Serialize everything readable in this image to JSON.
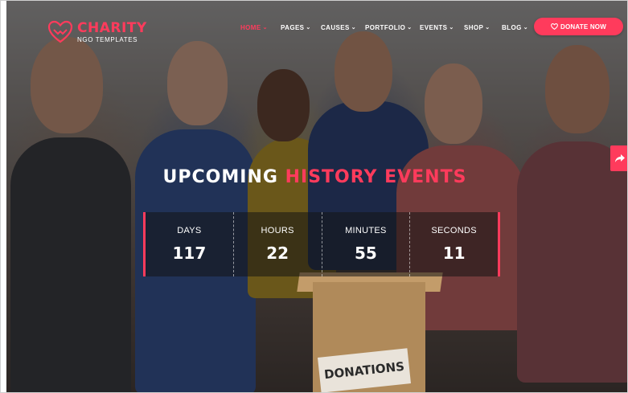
{
  "brand": {
    "name": "CHARITY",
    "tagline": "NGO TEMPLATES",
    "accent_color": "#ff3b5c",
    "logo_icon": "heart-hands-icon"
  },
  "nav": {
    "items": [
      {
        "label": "HOME",
        "has_caret": true,
        "active": true
      },
      {
        "label": "PAGES",
        "has_caret": true,
        "active": false
      },
      {
        "label": "CAUSES",
        "has_caret": true,
        "active": false
      },
      {
        "label": "PORTFOLIO",
        "has_caret": true,
        "active": false
      },
      {
        "label": "EVENTS",
        "has_caret": true,
        "active": false
      },
      {
        "label": "SHOP",
        "has_caret": true,
        "active": false
      },
      {
        "label": "BLOG",
        "has_caret": true,
        "active": false
      }
    ],
    "donate_label": "DONATE NOW",
    "donate_icon": "heart-icon"
  },
  "share": {
    "icon": "share-arrow-icon"
  },
  "hero": {
    "headline_white": "UPCOMING",
    "headline_pink": "HISTORY EVENTS",
    "box_label": "DONATIONS"
  },
  "countdown": [
    {
      "label": "DAYS",
      "value": "117"
    },
    {
      "label": "HOURS",
      "value": "22"
    },
    {
      "label": "MINUTES",
      "value": "55"
    },
    {
      "label": "SECONDS",
      "value": "11"
    }
  ]
}
